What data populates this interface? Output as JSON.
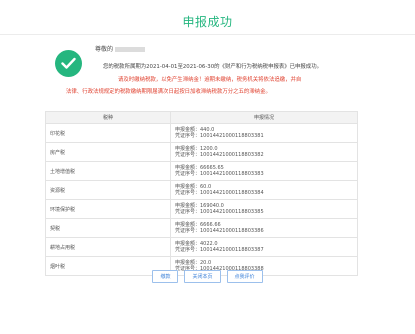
{
  "page": {
    "title": "申报成功"
  },
  "status": {
    "icon": "check-circle-icon",
    "accent_color": "#25b67f",
    "greeting": "尊敬的",
    "message_line1": "您的税款所属期为2021-04-01至2021-06-30的《财产和行为税纳税申报表》已申报成功。",
    "warning_line1": "请及时缴纳税款，以免产生滞纳金！逾期未缴纳，税务机关将依法追缴，并自",
    "warning_line2": "法律、行政法规规定的税款缴纳期限届满次日起按日加收滞纳税款万分之五的滞纳金。",
    "warning_color": "#e0412f"
  },
  "table": {
    "headers": [
      "税种",
      "申报情况"
    ],
    "rows": [
      {
        "tax": "印花税",
        "amount": "申报金额：440.0",
        "voucher": "凭证序号：10014421000118803381"
      },
      {
        "tax": "房产税",
        "amount": "申报金额：1200.0",
        "voucher": "凭证序号：10014421000118803382"
      },
      {
        "tax": "土地增值税",
        "amount": "申报金额：66665.65",
        "voucher": "凭证序号：10014421000118803383"
      },
      {
        "tax": "资源税",
        "amount": "申报金额：60.0",
        "voucher": "凭证序号：10014421000118803384"
      },
      {
        "tax": "环境保护税",
        "amount": "申报金额：169040.0",
        "voucher": "凭证序号：10014421000118803385"
      },
      {
        "tax": "契税",
        "amount": "申报金额：6666.66",
        "voucher": "凭证序号：10014421000118803386"
      },
      {
        "tax": "耕地占用税",
        "amount": "申报金额：4022.0",
        "voucher": "凭证序号：10014421000118803387"
      },
      {
        "tax": "烟叶税",
        "amount": "申报金额：20.0",
        "voucher": "凭证序号：10014421000118803388"
      }
    ]
  },
  "buttons": {
    "pay": "缴款",
    "close": "关闭本页",
    "review": "点我评价"
  }
}
